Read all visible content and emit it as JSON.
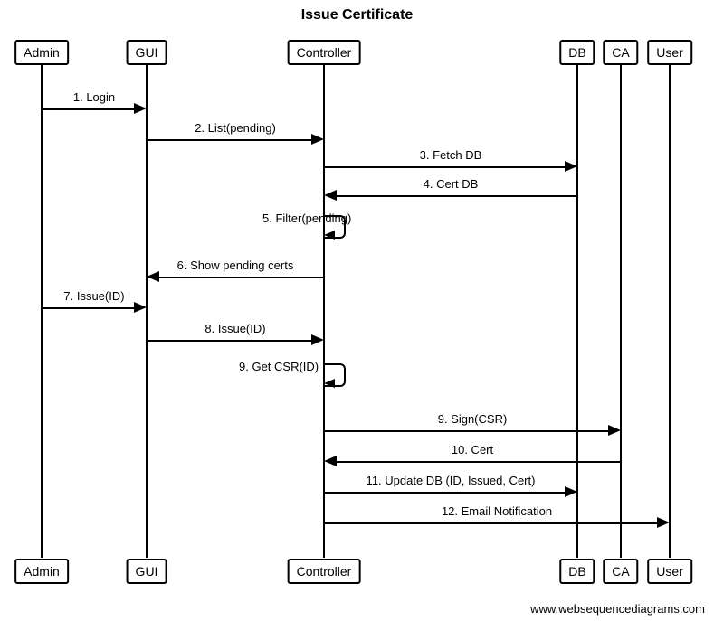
{
  "title": "Issue Certificate",
  "footer": "www.websequencediagrams.com",
  "actors": {
    "admin": "Admin",
    "gui": "GUI",
    "controller": "Controller",
    "db": "DB",
    "ca": "CA",
    "user": "User"
  },
  "messages": {
    "m1": "1. Login",
    "m2": "2. List(pending)",
    "m3": "3. Fetch DB",
    "m4": "4. Cert DB",
    "m5": "5. Filter(pending)",
    "m6": "6. Show pending certs",
    "m7": "7. Issue(ID)",
    "m8": "8. Issue(ID)",
    "m9": "9. Get CSR(ID)",
    "m9b": "9. Sign(CSR)",
    "m10": "10. Cert",
    "m11": "11. Update DB (ID, Issued, Cert)",
    "m12": "12. Email Notification"
  },
  "chart_data": {
    "type": "sequence-diagram",
    "title": "Issue Certificate",
    "participants": [
      "Admin",
      "GUI",
      "Controller",
      "DB",
      "CA",
      "User"
    ],
    "messages": [
      {
        "n": 1,
        "from": "Admin",
        "to": "GUI",
        "label": "Login"
      },
      {
        "n": 2,
        "from": "GUI",
        "to": "Controller",
        "label": "List(pending)"
      },
      {
        "n": 3,
        "from": "Controller",
        "to": "DB",
        "label": "Fetch DB"
      },
      {
        "n": 4,
        "from": "DB",
        "to": "Controller",
        "label": "Cert DB"
      },
      {
        "n": 5,
        "from": "Controller",
        "to": "Controller",
        "label": "Filter(pending)",
        "self": true
      },
      {
        "n": 6,
        "from": "Controller",
        "to": "GUI",
        "label": "Show pending certs"
      },
      {
        "n": 7,
        "from": "Admin",
        "to": "GUI",
        "label": "Issue(ID)"
      },
      {
        "n": 8,
        "from": "GUI",
        "to": "Controller",
        "label": "Issue(ID)"
      },
      {
        "n": 9,
        "from": "Controller",
        "to": "Controller",
        "label": "Get CSR(ID)",
        "self": true
      },
      {
        "n": 9,
        "from": "Controller",
        "to": "CA",
        "label": "Sign(CSR)"
      },
      {
        "n": 10,
        "from": "CA",
        "to": "Controller",
        "label": "Cert"
      },
      {
        "n": 11,
        "from": "Controller",
        "to": "DB",
        "label": "Update DB (ID, Issued, Cert)"
      },
      {
        "n": 12,
        "from": "Controller",
        "to": "User",
        "label": "Email Notification"
      }
    ]
  }
}
